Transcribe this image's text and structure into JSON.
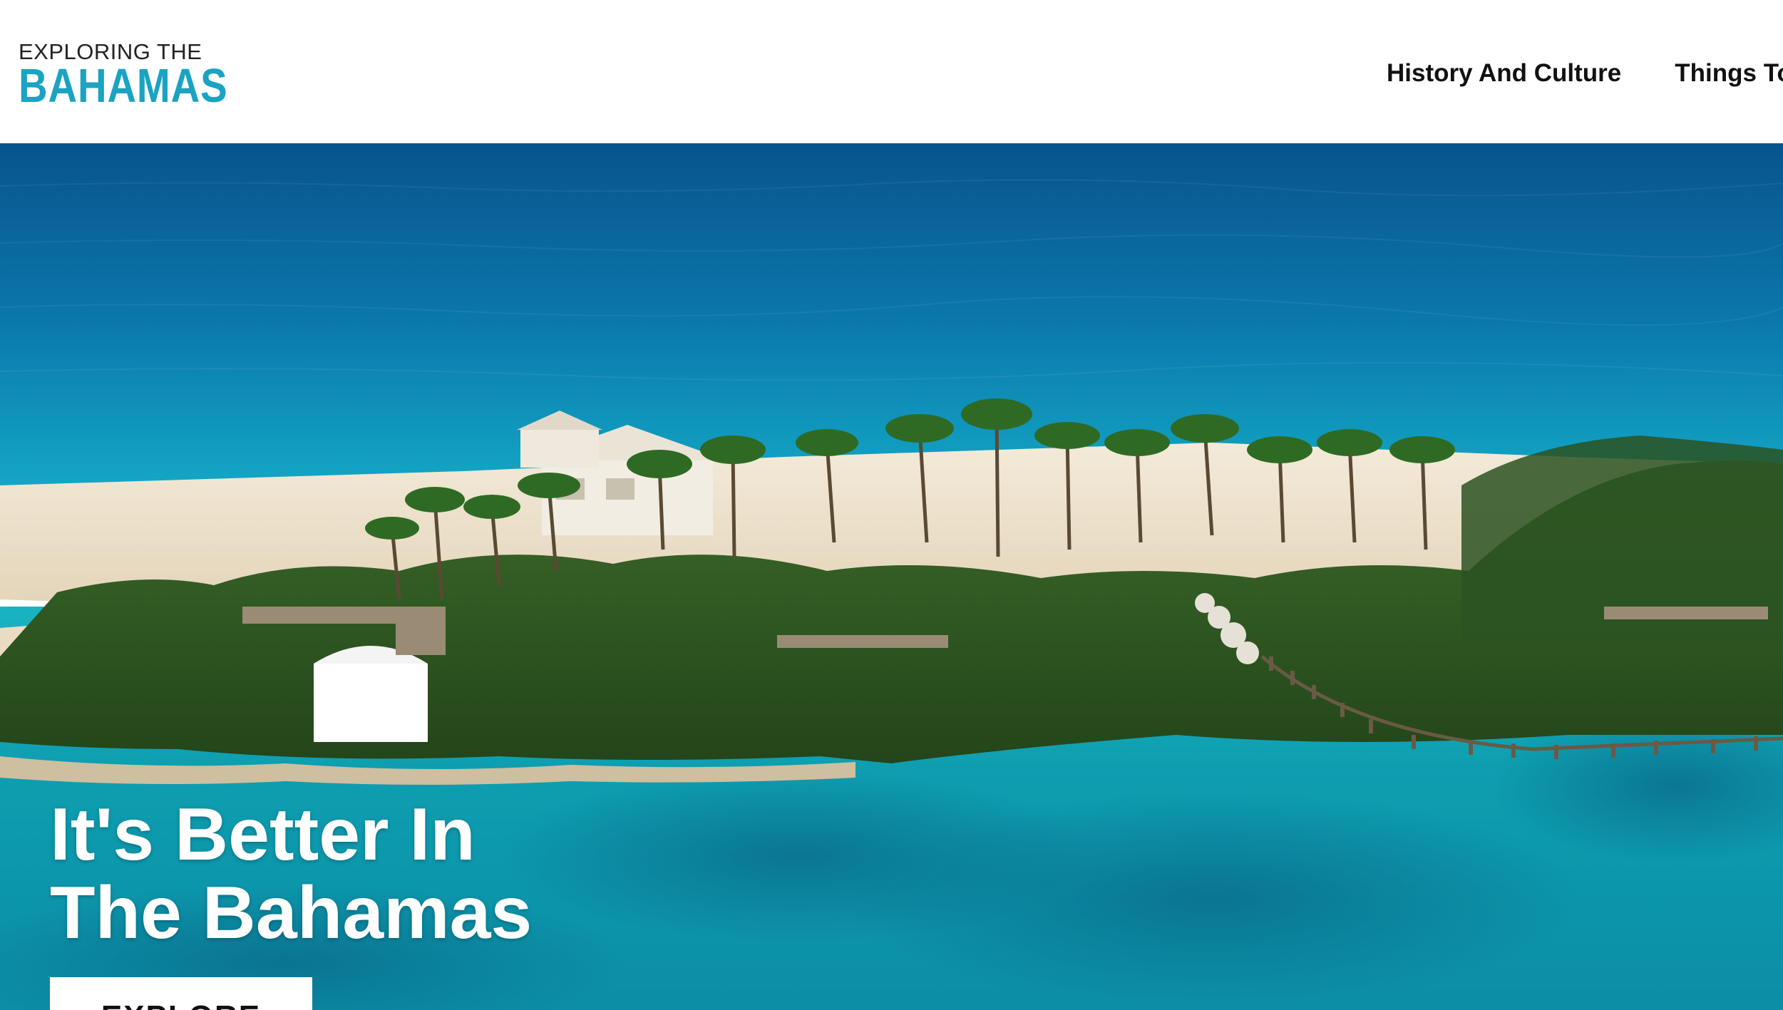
{
  "header": {
    "logo": {
      "line1": "EXPLORING THE",
      "line2": "BAHAMAS",
      "accent_color": "#1aa3c2"
    },
    "nav": [
      {
        "label": "History And Culture"
      },
      {
        "label": "Things To"
      }
    ]
  },
  "hero": {
    "title_line1": "It's Better In",
    "title_line2": "The Bahamas",
    "button_label": "EXPLORE",
    "image": "aerial-island-beach-palms"
  },
  "colors": {
    "ocean_deep": "#0a5f96",
    "ocean_lagoon": "#0fa6b8",
    "sand": "#efe3cf",
    "palm": "#2f5a22"
  }
}
